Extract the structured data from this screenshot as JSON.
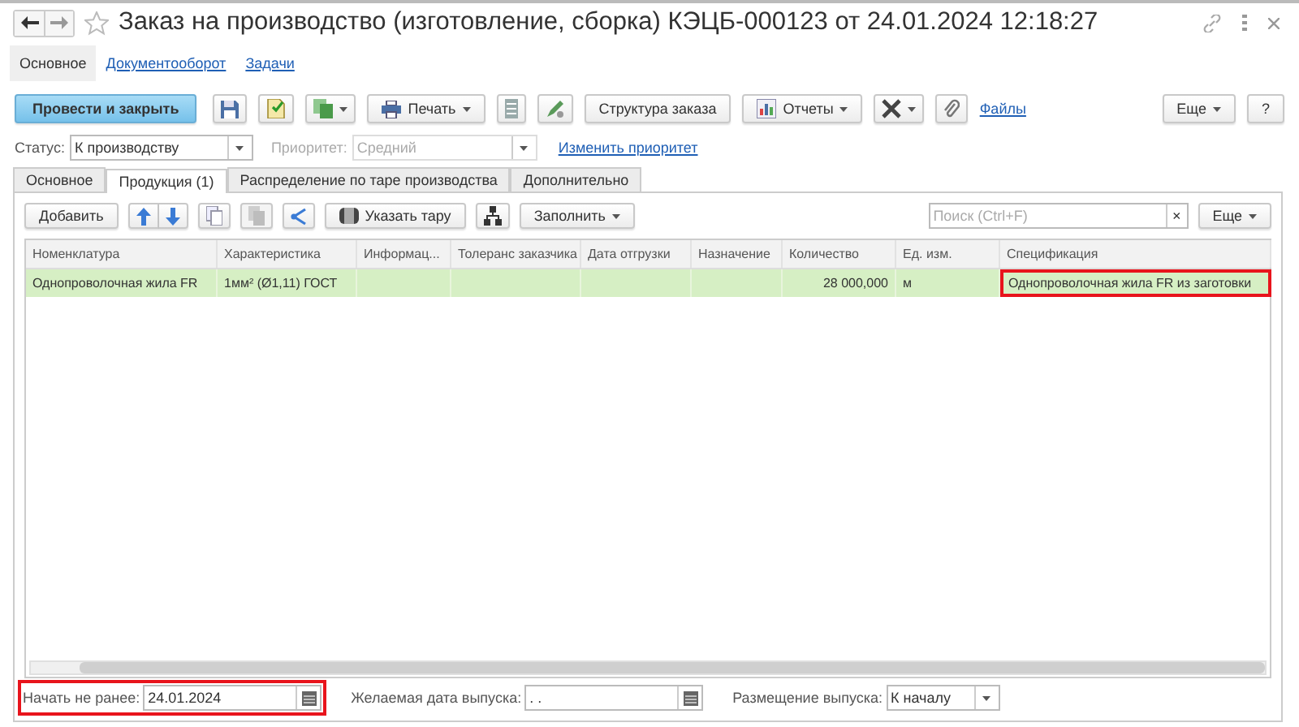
{
  "window": {
    "title": "Заказ на производство (изготовление, сборка) КЭЦБ-000123 от 24.01.2024 12:18:27",
    "favorite": false
  },
  "section_tabs": [
    {
      "label": "Основное",
      "selected": true
    },
    {
      "label": "Документооборот",
      "selected": false
    },
    {
      "label": "Задачи",
      "selected": false
    }
  ],
  "toolbar": [
    {
      "kind": "primary",
      "label": "Провести и закрыть"
    },
    {
      "kind": "icon",
      "dropdown": false
    },
    {
      "kind": "icon",
      "dropdown": false
    },
    {
      "kind": "icon",
      "dropdown": true
    },
    {
      "kind": "button",
      "label": "Печать",
      "dropdown": true
    },
    {
      "kind": "icon",
      "dropdown": false
    },
    {
      "kind": "icon",
      "dropdown": false
    },
    {
      "kind": "button",
      "label": "Структура заказа",
      "dropdown": false
    },
    {
      "kind": "button",
      "label": "Отчеты",
      "dropdown": true
    },
    {
      "kind": "icon",
      "dropdown": true
    },
    {
      "kind": "icon",
      "dropdown": false
    },
    {
      "kind": "link",
      "label": "Файлы"
    }
  ],
  "toolbar_right": [
    {
      "label": "Еще",
      "dropdown": true
    },
    {
      "label": "?",
      "dropdown": false
    }
  ],
  "status": {
    "label": "Статус:",
    "value": "К производству",
    "disabled": false
  },
  "priority": {
    "label": "Приоритет:",
    "value": "Средний",
    "disabled": true
  },
  "change_priority_link": "Изменить приоритет",
  "tabs": [
    {
      "label": "Основное",
      "selected": false
    },
    {
      "label": "Продукция (1)",
      "selected": true
    },
    {
      "label": "Распределение по таре производства",
      "selected": false
    },
    {
      "label": "Дополнительно",
      "selected": false
    }
  ],
  "table_toolbar": [
    {
      "kind": "button",
      "label": "Добавить",
      "dropdown": false,
      "disabled": false
    },
    {
      "kind": "arrows",
      "disabled": false
    },
    {
      "kind": "icon",
      "disabled": false
    },
    {
      "kind": "icon",
      "disabled": true
    },
    {
      "kind": "icon",
      "disabled": false
    },
    {
      "kind": "button",
      "label": "Указать тару",
      "dropdown": false,
      "disabled": false
    },
    {
      "kind": "icon",
      "disabled": false
    },
    {
      "kind": "button",
      "label": "Заполнить",
      "dropdown": true,
      "disabled": false
    }
  ],
  "search": {
    "placeholder": "Поиск (Ctrl+F)",
    "clear": "×"
  },
  "table_more": {
    "label": "Еще",
    "dropdown": true
  },
  "table": {
    "columns": [
      {
        "label": "Номенклатура"
      },
      {
        "label": "Характеристика"
      },
      {
        "label": "Информац..."
      },
      {
        "label": "Толеранс заказчика"
      },
      {
        "label": "Дата отгрузки"
      },
      {
        "label": "Назначение"
      },
      {
        "label": "Количество"
      },
      {
        "label": "Ед. изм."
      },
      {
        "label": "Спецификация"
      }
    ],
    "rows": [
      {
        "selected": true,
        "cells": [
          {
            "text": "Однопроволочная жила FR",
            "numeric": false,
            "highlighted": false
          },
          {
            "text": "1мм² (Ø1,11) ГОСТ",
            "numeric": false,
            "highlighted": false
          },
          {
            "highlighted": false
          },
          {
            "highlighted": false
          },
          {
            "highlighted": false
          },
          {
            "highlighted": false
          },
          {
            "text": "28 000,000",
            "numeric": true,
            "highlighted": false
          },
          {
            "text": "м",
            "numeric": false,
            "highlighted": false
          },
          {
            "text": "Однопроволочная жила FR из заготовки",
            "numeric": false,
            "highlighted": true
          }
        ]
      }
    ]
  },
  "bottom_fields": [
    {
      "kind": "date",
      "label": "Начать не ранее:",
      "value": "24.01.2024",
      "highlighted": true
    },
    {
      "kind": "date",
      "label": "Желаемая дата выпуска:",
      "value": " .  .",
      "highlighted": false
    },
    {
      "kind": "select",
      "label": "Размещение выпуска:",
      "value": "К началу",
      "highlighted": false
    }
  ]
}
